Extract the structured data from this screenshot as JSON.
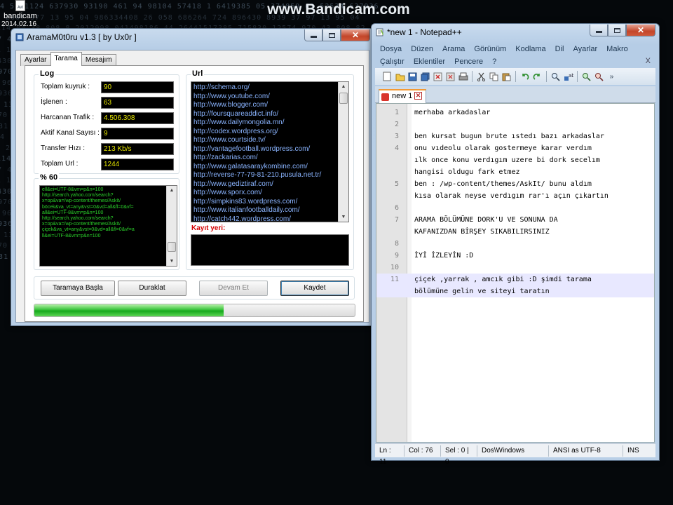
{
  "desktop": {
    "watermark": "www.Bandicam.com",
    "icon_name": "bandicam",
    "icon_date": "2014.02.16",
    "bg_rows": [
      "4 51  1124  637930  93190  461  94  98104  57418  1 6419385  05  374859  62  52534  637936",
      "15  2007  977  13  95  04  986334408  26  058  686264  724  896430  8939  37  97  13  95  04",
      "28  114  04  38  808 8 2012998  041498186  44  26441517385   715830  12574  970  43  808  82",
      "5350  7 4918  4  9609  11 31 1  999  2495891  269  19  70  53  256541  6950  7 4918  4  9609",
      "01 15  62  52534  637936  93190  461  94  98104  57418  1 6419385  05  374859  62  52534  637",
      "896430  8939  37  97  13  95  04  986334408  26  058  686264  724  896430  8939  37  97  13",
      "3574  970  43  808  82012998  041498186  44  26441517385    715830  12574  970  43  808  82",
      "4  9609  11 31 1  999  2495891  269  19  70  53  256541  6950  7 4918  4  9609  11 31 1  999",
      "637936  93190  461  94  98104  57418  1 6419385  05  374859  62  52534  637936  93190  461",
      "37  97  13  95  04  986334408  26  058  686264  724  896430  8939  37  97  13  95  04  98633",
      "970  43  808  82012998  041498186  44  26441517385    715830  12574  970  43  808  82012998",
      "11 31 1  999  2495891  269  19  70  53  256541  6950  7 4918  4  9609  11 31 1  999  249589"
    ]
  },
  "arama": {
    "title": "AramaM0t0ru v1.3 [ by Ux0r ]",
    "tabs": [
      "Ayarlar",
      "Tarama",
      "Mesajım"
    ],
    "log": {
      "title": "Log",
      "fields": [
        {
          "label": "Toplam kuyruk :",
          "value": "90"
        },
        {
          "label": "İşlenen :",
          "value": "63"
        },
        {
          "label": "Harcanan Trafik :",
          "value": "4.506.308"
        },
        {
          "label": "Aktif Kanal Sayısı :",
          "value": "9"
        },
        {
          "label": "Transfer Hızı :",
          "value": "213 Kb/s"
        },
        {
          "label": "Toplam Url :",
          "value": "1244"
        }
      ]
    },
    "percent": {
      "title": "% 60",
      "log_text": "ell&ei=UTF-8&vm=p&n=100\nhttp://search.yahoo.com/search?\nx=op&va=/wp-content/themes/AskIt/\nböcek&va_vt=any&vst=0&vd=all&fl=0&vf=\nall&ei=UTF-8&vm=p&n=100\nhttp://search.yahoo.com/search?\nx=op&va=/wp-content/themes/AskIt/\nçiçek&va_vt=any&vst=0&vd=all&fl=0&vf=a\nll&ei=UTF-8&vm=p&n=100"
    },
    "url": {
      "title": "Url",
      "items": [
        "http://schema.org/",
        "http://www.youtube.com/",
        "http://www.blogger.com/",
        "http://foursquareaddict.info/",
        "http://www.dailymongolia.mn/",
        "http://codex.wordpress.org/",
        "http://www.courtside.tv/",
        "http://vantagefootball.wordpress.com/",
        "http://zackarias.com/",
        "http://www.galatasaraykombine.com/",
        "http://reverse-77-79-81-210.pusula.net.tr/",
        "http://www.gediztiraf.com/",
        "http://www.sporx.com/",
        "http://simpkins83.wordpress.com/",
        "http://www.italianfootballdaily.com/",
        "http://catch442.wordpress.com/"
      ]
    },
    "kayit_label": "Kayıt yeri:",
    "buttons": {
      "start": "Taramaya Başla",
      "pause": "Duraklat",
      "resume": "Devam Et",
      "save": "Kaydet"
    },
    "progress": 0.59
  },
  "npp": {
    "title": "*new 1 - Notepad++",
    "menu_row1": [
      "Dosya",
      "Düzen",
      "Arama",
      "Görünüm",
      "Kodlama",
      "Dil",
      "Ayarlar",
      "Makro"
    ],
    "menu_row2": [
      "Çalıştır",
      "Eklentiler",
      "Pencere",
      "?"
    ],
    "menu_close": "X",
    "tab_label": "new 1",
    "lines": [
      {
        "n": "1",
        "t": "merhaba arkadaslar"
      },
      {
        "n": "2",
        "t": ""
      },
      {
        "n": "3",
        "t": "ben kursat bugun brute ıstedı bazı arkadaslar"
      },
      {
        "n": "4",
        "t": "onu vıdeolu olarak gostermeye karar verdım"
      },
      {
        "n": "",
        "t": "ılk once konu verdıgım uzere bi dork secelım"
      },
      {
        "n": "",
        "t": "hangisi oldugu fark etmez"
      },
      {
        "n": "5",
        "t": "ben : /wp-content/themes/AskIt/ bunu aldım"
      },
      {
        "n": "",
        "t": "kısa olarak neyse verdıgım rar'ı açın çıkartın"
      },
      {
        "n": "6",
        "t": ""
      },
      {
        "n": "7",
        "t": "ARAMA BÖLÜMÜNE DORK'U VE SONUNA DA"
      },
      {
        "n": "",
        "t": "KAFANIZDAN BİRŞEY SIKABILIRSINIZ"
      },
      {
        "n": "8",
        "t": ""
      },
      {
        "n": "9",
        "t": "İYİ İZLEYİN :D"
      },
      {
        "n": "10",
        "t": ""
      },
      {
        "n": "11",
        "t": "çiçek ,yarrak , amcık gibi :D şimdi tarama"
      },
      {
        "n": "",
        "t": "bölümüne gelin ve siteyi taratın"
      }
    ],
    "status": {
      "ln": "Ln : 11",
      "col": "Col : 76",
      "sel": "Sel : 0 | 0",
      "eol": "Dos\\Windows",
      "enc": "ANSI as UTF-8",
      "ins": "INS"
    }
  }
}
